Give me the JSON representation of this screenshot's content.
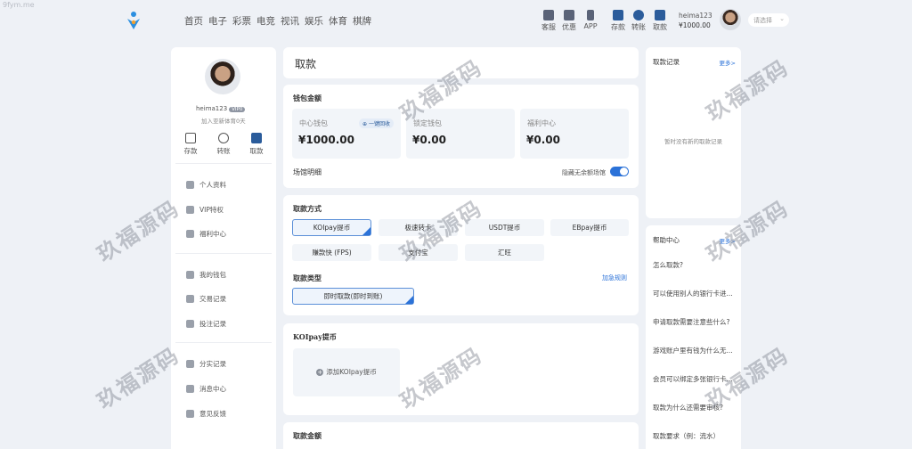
{
  "site_watermark": "9fym.me",
  "watermark_text": "玖福源码",
  "nav": [
    "首页",
    "电子",
    "彩票",
    "电竞",
    "视讯",
    "娱乐",
    "体育",
    "棋牌"
  ],
  "top_icons": [
    {
      "label": "客服",
      "icon": "chat-icon"
    },
    {
      "label": "优惠",
      "icon": "gift-icon"
    },
    {
      "label": "APP",
      "icon": "phone-icon"
    },
    {
      "label": "存款",
      "icon": "deposit-icon"
    },
    {
      "label": "转账",
      "icon": "transfer-icon"
    },
    {
      "label": "取款",
      "icon": "withdraw-icon"
    }
  ],
  "user": {
    "name": "heima123",
    "balance": "¥1000.00",
    "select_placeholder": "请选择"
  },
  "sidebar": {
    "name": "heima123",
    "vip": "VIP0",
    "joined": "加入亚新体育0天",
    "quick": [
      "存款",
      "转账",
      "取款"
    ],
    "menu_group1": [
      "个人资料",
      "VIP特权",
      "福利中心"
    ],
    "menu_group2": [
      "我的钱包",
      "交易记录",
      "投注记录"
    ],
    "menu_group3": [
      "分实记录",
      "消息中心",
      "意见反馈"
    ]
  },
  "main": {
    "title": "取款",
    "wallet_section": "钱包金额",
    "wallets": [
      {
        "label": "中心钱包",
        "amount": "¥1000.00"
      },
      {
        "label": "锁定钱包",
        "amount": "¥0.00"
      },
      {
        "label": "福利中心",
        "amount": "¥0.00"
      }
    ],
    "one_click": "一键回收",
    "venue_detail": "场馆明细",
    "hide_label": "隐藏无余额场馆",
    "hide_enabled": true,
    "method_section": "取款方式",
    "methods_row1": [
      "KOIpay提币",
      "极速转卡",
      "USDT提币",
      "EBpay提币"
    ],
    "methods_row2": [
      "赚款快 (FPS)",
      "支付宝",
      "汇旺"
    ],
    "selected_method": "KOIpay提币",
    "type_section": "取款类型",
    "rules_link": "加急规则",
    "type_option": "即时取款(即时到账)",
    "koipay_section": "KOIpay提币",
    "add_koipay": "添加KOIpay提币",
    "amount_section": "取款金额"
  },
  "records": {
    "title": "取款记录",
    "more": "更多>",
    "empty": "暂时没有新的取款记录"
  },
  "help": {
    "title": "帮助中心",
    "more": "更多>",
    "items": [
      "怎么取款?",
      "可以使用别人的银行卡进...",
      "申请取款需要注意些什么?",
      "游戏账户里有钱为什么无...",
      "会员可以绑定多张银行卡...",
      "取款为什么还需要审核?",
      "取款要求（例：流水）"
    ]
  }
}
